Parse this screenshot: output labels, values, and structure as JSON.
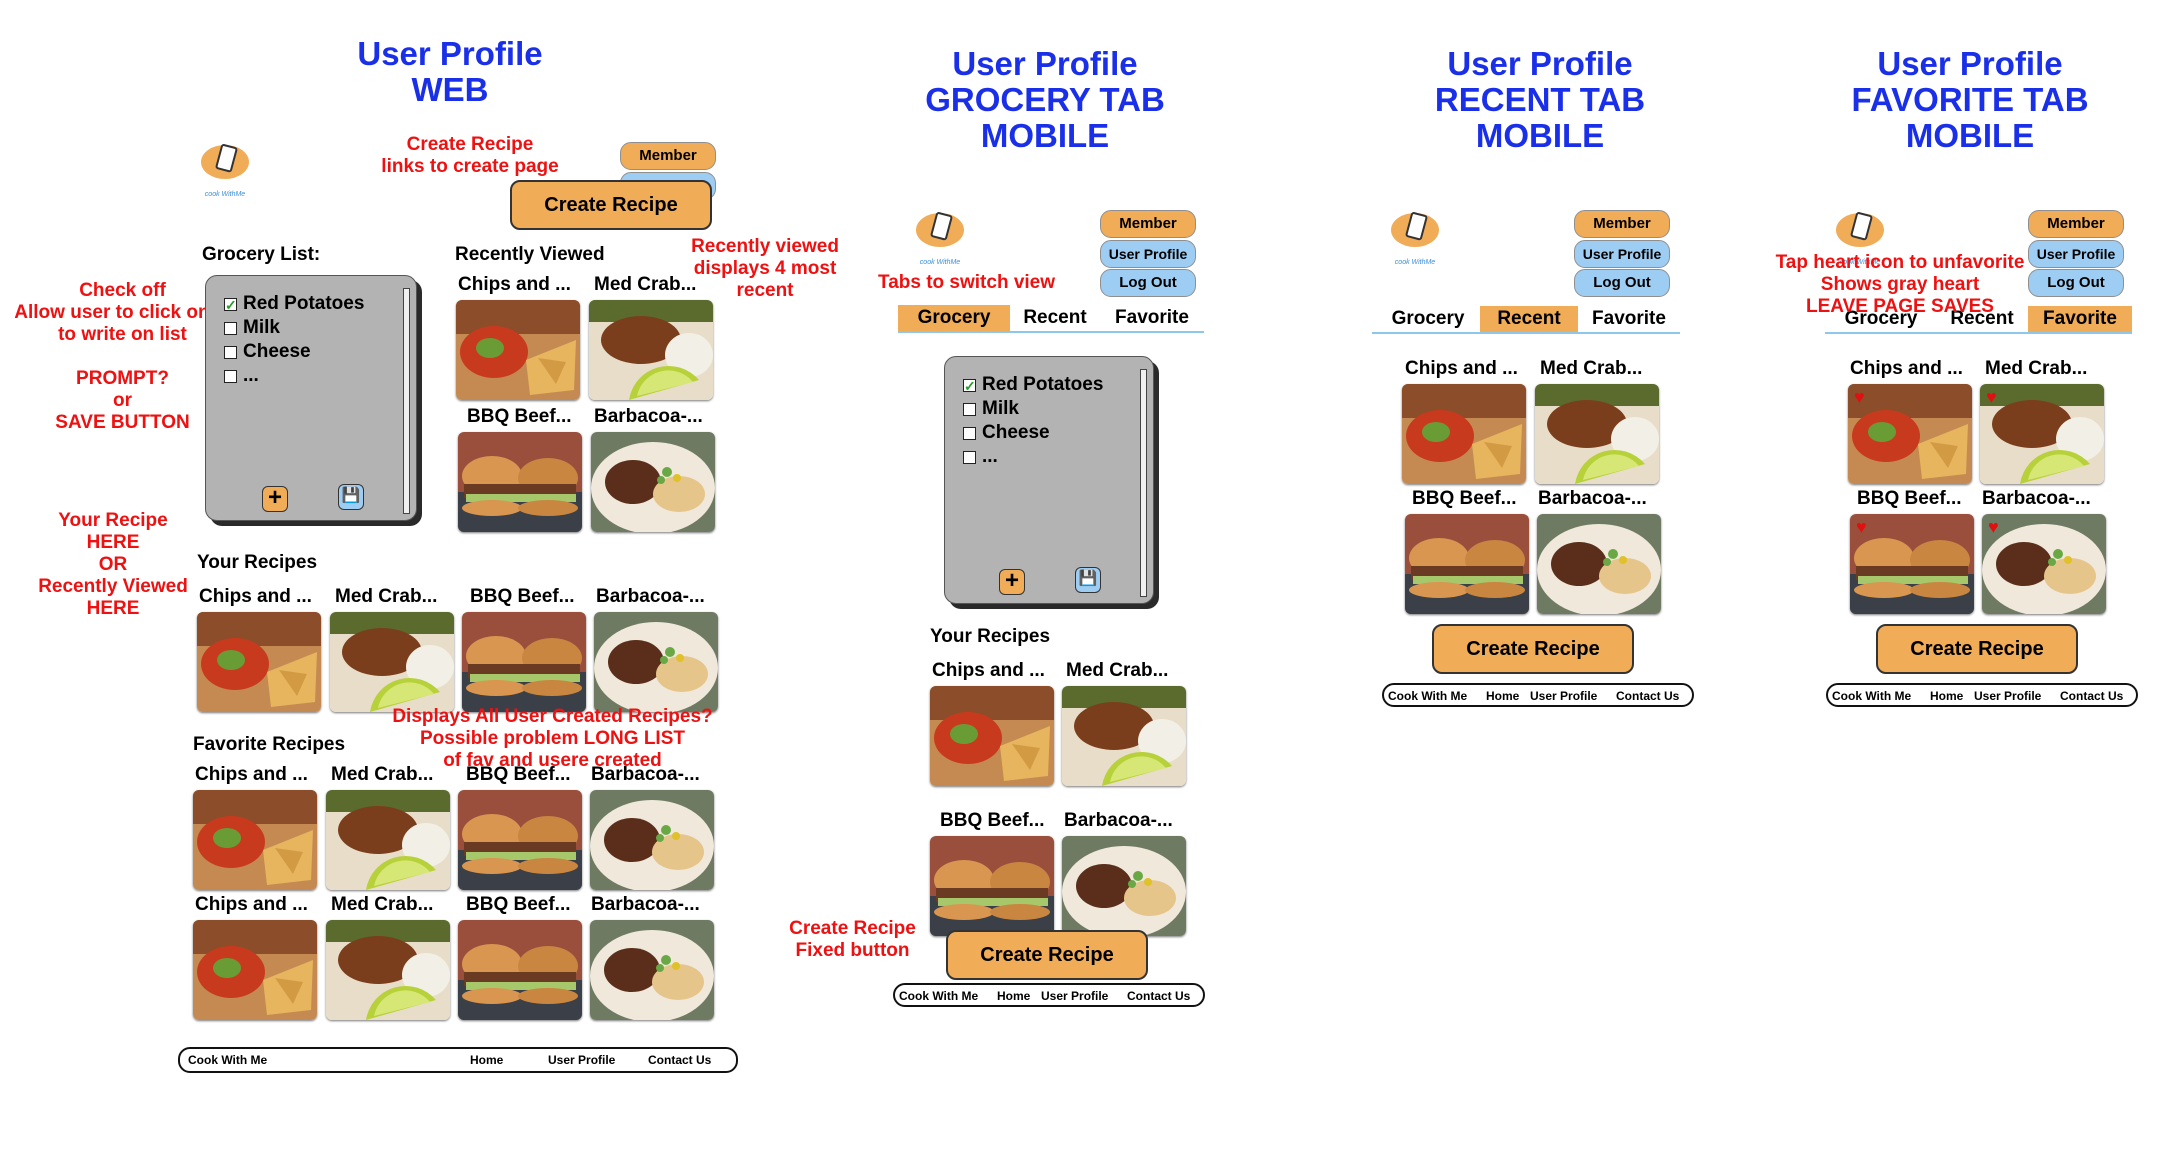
{
  "colors": {
    "title_blue": "#1a2fe8",
    "annotation_red": "#ee1111",
    "accent_orange": "#f1ac58",
    "accent_blue": "#9ecdf4",
    "panel_gray": "#b3b3b3"
  },
  "titles": {
    "web": [
      "User Profile",
      "WEB"
    ],
    "grocery": [
      "User Profile",
      "GROCERY TAB",
      "MOBILE"
    ],
    "recent": [
      "User Profile",
      "RECENT TAB",
      "MOBILE"
    ],
    "favorite": [
      "User Profile",
      "FAVORITE TAB",
      "MOBILE"
    ]
  },
  "logo_text": "cook WithMe",
  "header_buttons": {
    "member": "Member",
    "user_profile": "User Profile",
    "log_out": "Log Out"
  },
  "create_recipe": "Create Recipe",
  "grocery_list": {
    "title": "Grocery List:",
    "items": [
      {
        "label": "Red Potatoes",
        "checked": true
      },
      {
        "label": "Milk",
        "checked": false
      },
      {
        "label": "Cheese",
        "checked": false
      },
      {
        "label": "...",
        "checked": false
      }
    ],
    "add_icon": "plus-icon",
    "save_icon": "floppy-disk-icon"
  },
  "sections": {
    "recently_viewed": "Recently Viewed",
    "your_recipes": "Your Recipes",
    "favorite_recipes": "Favorite Recipes"
  },
  "recipes": [
    {
      "name": "Chips and ...",
      "photo": "chips-and-salsa-photo"
    },
    {
      "name": "Med Crab...",
      "photo": "crab-cake-with-lime-photo"
    },
    {
      "name": "BBQ Beef...",
      "photo": "bbq-beef-sandwich-photo"
    },
    {
      "name": "Barbacoa-...",
      "photo": "barbacoa-plate-photo"
    }
  ],
  "tabs": [
    "Grocery",
    "Recent",
    "Favorite"
  ],
  "footer": {
    "brand": "Cook With Me",
    "home": "Home",
    "user_profile": "User Profile",
    "contact": "Contact Us"
  },
  "annotations": {
    "create_recipe_link": [
      "Create Recipe",
      "links to create page"
    ],
    "recently_viewed": [
      "Recently viewed",
      "displays 4 most",
      "recent"
    ],
    "check_off": [
      "Check off",
      "Allow user to click on ...",
      "to write on list",
      "",
      "PROMPT?",
      "or",
      "SAVE BUTTON"
    ],
    "your_recipe": [
      "Your Recipe",
      "HERE",
      "OR",
      "Recently Viewed",
      "HERE"
    ],
    "displays_all": [
      "Displays All User Created Recipes?",
      "Possible problem LONG LIST",
      "of fav and usere created"
    ],
    "tabs_switch": "Tabs to switch view",
    "create_fixed": [
      "Create Recipe",
      "Fixed button"
    ],
    "tap_heart": [
      "Tap heart icon to unfavorite",
      "Shows gray heart",
      "LEAVE PAGE SAVES"
    ]
  }
}
